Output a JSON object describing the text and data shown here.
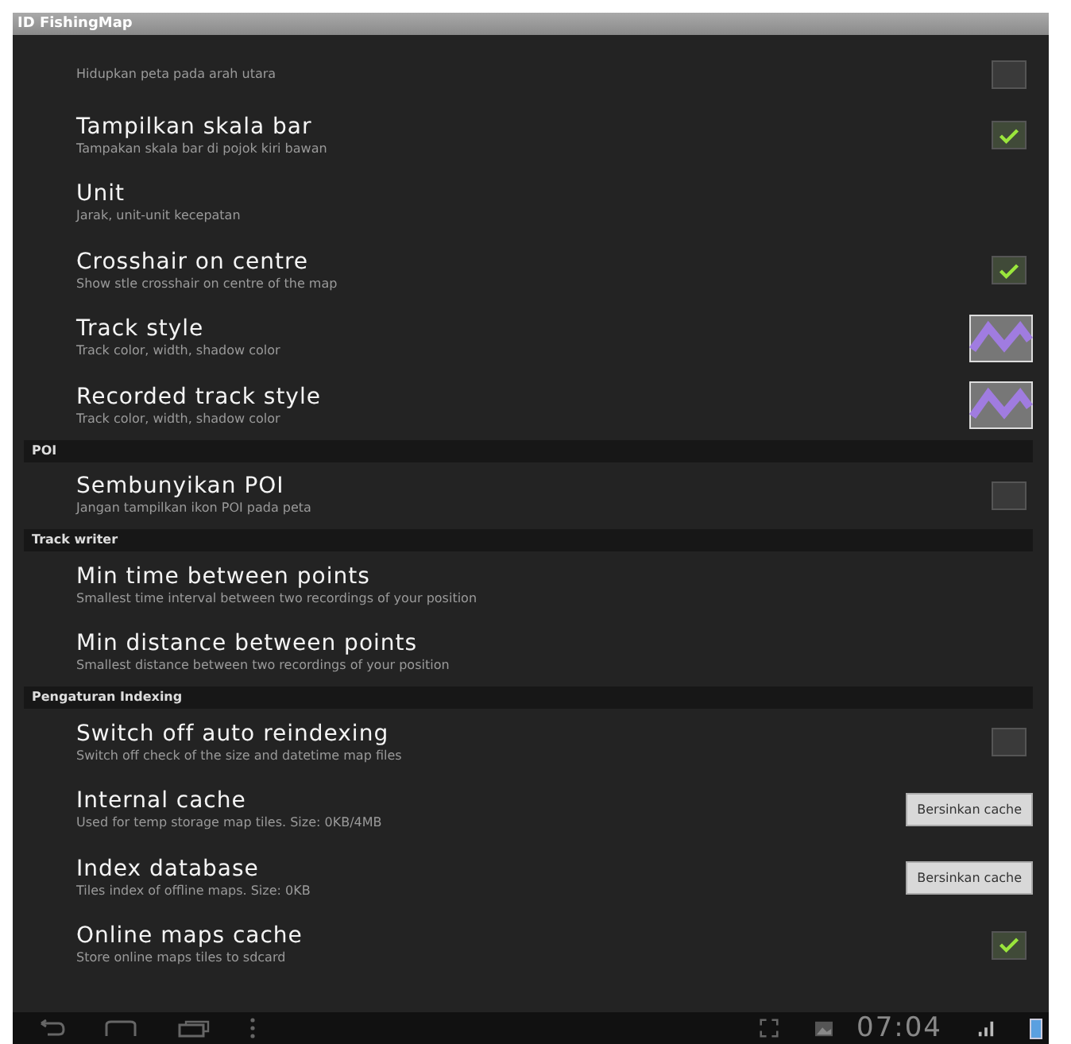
{
  "window": {
    "title": "ID FishingMap"
  },
  "settings": [
    {
      "kind": "checkbox",
      "subtitle": "Hidupkan peta pada arah utara",
      "checked": false
    },
    {
      "kind": "checkbox",
      "title": "Tampilkan skala bar",
      "subtitle": "Tampakan skala bar di pojok kiri bawan",
      "checked": true
    },
    {
      "kind": "plain",
      "title": "Unit",
      "subtitle": "Jarak, unit-unit kecepatan"
    },
    {
      "kind": "checkbox",
      "title": "Crosshair on centre",
      "subtitle": "Show stle crosshair on centre of the map",
      "checked": true
    },
    {
      "kind": "style",
      "title": "Track style",
      "subtitle": "Track color, width, shadow color"
    },
    {
      "kind": "style",
      "title": "Recorded track style",
      "subtitle": "Track color, width, shadow color"
    },
    {
      "kind": "header",
      "title": "POI"
    },
    {
      "kind": "checkbox",
      "title": "Sembunyikan POI",
      "subtitle": "Jangan tampilkan ikon POI pada peta",
      "checked": false
    },
    {
      "kind": "header",
      "title": "Track writer"
    },
    {
      "kind": "plain",
      "title": "Min time between points",
      "subtitle": "Smallest time interval between two recordings of your position"
    },
    {
      "kind": "plain",
      "title": "Min distance between points",
      "subtitle": "Smallest distance between two recordings of your position"
    },
    {
      "kind": "header",
      "title": "Pengaturan Indexing"
    },
    {
      "kind": "checkbox",
      "title": "Switch off auto reindexing",
      "subtitle": "Switch off check of the size and datetime map files",
      "checked": false
    },
    {
      "kind": "button",
      "title": "Internal cache",
      "subtitle": "Used for temp storage map tiles. Size: 0KB/4MB",
      "button": "Bersinkan cache"
    },
    {
      "kind": "button",
      "title": "Index database",
      "subtitle": "Tiles index of offline maps. Size: 0KB",
      "button": "Bersinkan cache"
    },
    {
      "kind": "checkbox",
      "title": "Online maps cache",
      "subtitle": "Store online maps tiles to sdcard",
      "checked": true
    }
  ],
  "status_bar": {
    "time": "07:04"
  }
}
